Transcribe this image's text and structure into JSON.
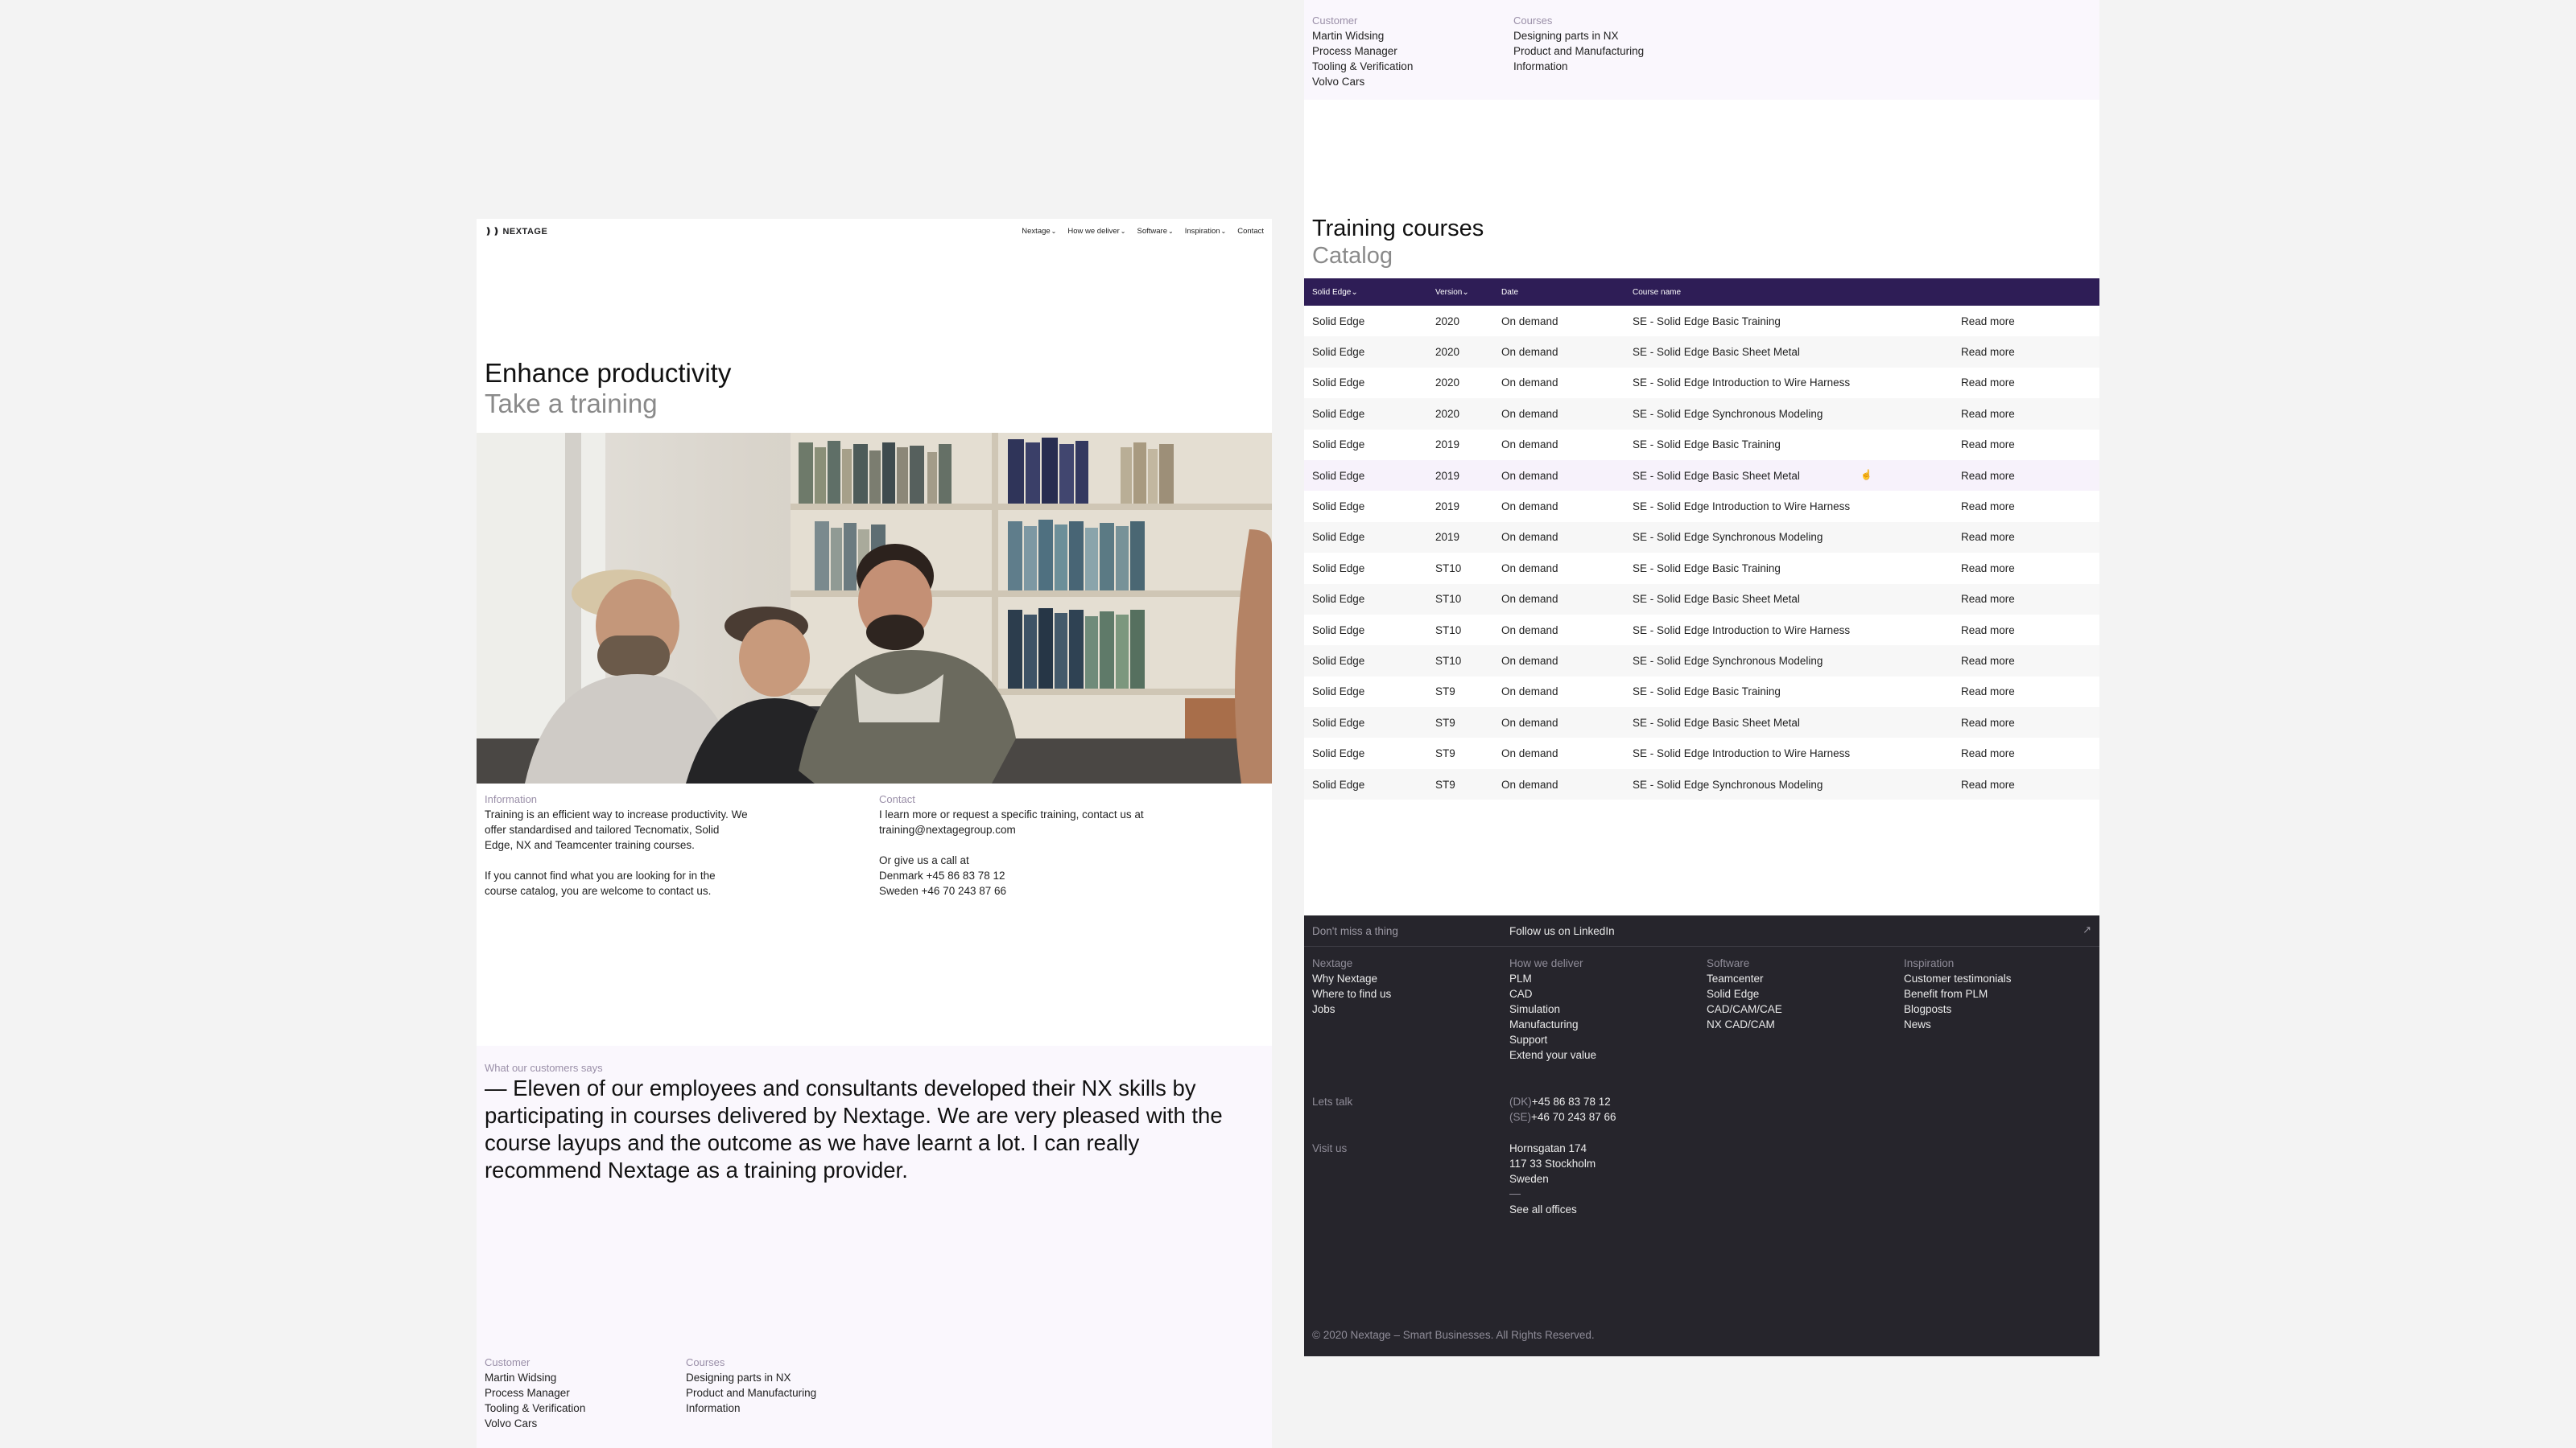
{
  "header": {
    "logo_text": "NEXTAGE",
    "nav": [
      {
        "label": "Nextage",
        "chevron": true
      },
      {
        "label": "How we deliver",
        "chevron": true
      },
      {
        "label": "Software",
        "chevron": true
      },
      {
        "label": "Inspiration",
        "chevron": true
      },
      {
        "label": "Contact",
        "chevron": false
      }
    ]
  },
  "hero": {
    "title": "Enhance productivity",
    "subtitle": "Take a training"
  },
  "info": {
    "label": "Information",
    "p1": "Training is an efficient way to increase productivity. We offer standardised and tailored Tecnomatix, Solid Edge, NX and Teamcenter training courses.",
    "p2": "If you cannot find what you are looking for in the course catalog, you are welcome to contact us."
  },
  "contact": {
    "label": "Contact",
    "p1": "I learn more or request a specific training, contact us at training@nextagegroup.com",
    "call": "Or give us a call at",
    "dk": "Denmark +45 86 83 78 12",
    "se": "Sweden +46 70 243 87 66"
  },
  "testimonial": {
    "label": "What our customers says",
    "quote": "— Eleven of our employees and consultants developed their NX skills by participating in courses delivered by Nextage. We are very pleased with the course layups and the outcome as we have learnt a lot. I can really recommend Nextage as a training provider."
  },
  "customer": {
    "label": "Customer",
    "lines": [
      "Martin Widsing",
      "Process Manager",
      "Tooling & Verification",
      "Volvo Cars"
    ]
  },
  "courses": {
    "label": "Courses",
    "lines": [
      "Designing parts in NX",
      "Product and Manufacturing",
      "Information"
    ]
  },
  "training": {
    "title": "Training courses",
    "subtitle": "Catalog",
    "headers": {
      "product": "Solid Edge",
      "version": "Version",
      "date": "Date",
      "course": "Course name"
    },
    "read_more": "Read more",
    "rows": [
      [
        "Solid Edge",
        "2020",
        "On demand",
        "SE - Solid Edge Basic Training"
      ],
      [
        "Solid Edge",
        "2020",
        "On demand",
        "SE - Solid Edge Basic Sheet Metal"
      ],
      [
        "Solid Edge",
        "2020",
        "On demand",
        "SE - Solid Edge Introduction to Wire Harness"
      ],
      [
        "Solid Edge",
        "2020",
        "On demand",
        "SE - Solid Edge Synchronous Modeling"
      ],
      [
        "Solid Edge",
        "2019",
        "On demand",
        "SE - Solid Edge Basic Training"
      ],
      [
        "Solid Edge",
        "2019",
        "On demand",
        "SE - Solid Edge Basic Sheet Metal"
      ],
      [
        "Solid Edge",
        "2019",
        "On demand",
        "SE - Solid Edge Introduction to Wire Harness"
      ],
      [
        "Solid Edge",
        "2019",
        "On demand",
        "SE - Solid Edge Synchronous Modeling"
      ],
      [
        "Solid Edge",
        "ST10",
        "On demand",
        "SE - Solid Edge Basic Training"
      ],
      [
        "Solid Edge",
        "ST10",
        "On demand",
        "SE - Solid Edge Basic Sheet Metal"
      ],
      [
        "Solid Edge",
        "ST10",
        "On demand",
        "SE - Solid Edge Introduction to Wire Harness"
      ],
      [
        "Solid Edge",
        "ST10",
        "On demand",
        "SE - Solid Edge Synchronous Modeling"
      ],
      [
        "Solid Edge",
        "ST9",
        "On demand",
        "SE - Solid Edge Basic Training"
      ],
      [
        "Solid Edge",
        "ST9",
        "On demand",
        "SE - Solid Edge Basic Sheet Metal"
      ],
      [
        "Solid Edge",
        "ST9",
        "On demand",
        "SE - Solid Edge Introduction to Wire Harness"
      ],
      [
        "Solid Edge",
        "ST9",
        "On demand",
        "SE - Solid Edge Synchronous Modeling"
      ]
    ]
  },
  "footer": {
    "dont_miss": "Don't miss a thing",
    "follow": "Follow us on LinkedIn",
    "columns": [
      {
        "label": "Nextage",
        "items": [
          "Why Nextage",
          "Where to find us",
          "Jobs"
        ]
      },
      {
        "label": "How we deliver",
        "items": [
          "PLM",
          "CAD",
          "Simulation",
          "Manufacturing",
          "Support",
          "Extend your value"
        ]
      },
      {
        "label": "Software",
        "items": [
          "Teamcenter",
          "Solid Edge",
          "CAD/CAM/CAE",
          "NX CAD/CAM"
        ]
      },
      {
        "label": "Inspiration",
        "items": [
          "Customer testimonials",
          "Benefit from PLM",
          "Blogposts",
          "News"
        ]
      }
    ],
    "lets_talk": "Lets talk",
    "phone_dk_prefix": "(DK)",
    "phone_dk": "+45 86 83 78 12",
    "phone_se_prefix": "(SE)",
    "phone_se": "+46 70 243 87 66",
    "visit_us": "Visit us",
    "address": [
      "Hornsgatan 174",
      "117 33 Stockholm",
      "Sweden"
    ],
    "see_all": "See all offices",
    "copyright": "© 2020 Nextage – Smart Businesses. All Rights Reserved."
  }
}
